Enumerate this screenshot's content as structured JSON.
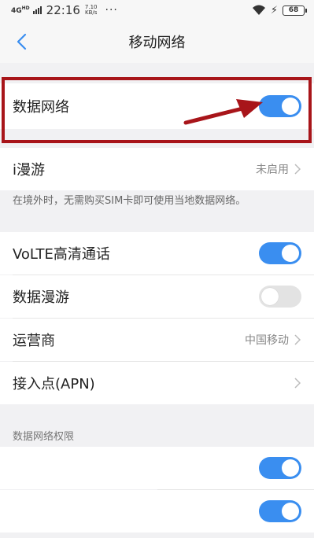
{
  "status_bar": {
    "network": "4G",
    "network_sup": "HD",
    "time": "22:16",
    "speed_value": "7.10",
    "speed_unit": "KB/s",
    "more": "···",
    "battery": "68"
  },
  "header": {
    "title": "移动网络",
    "back_icon": "chevron-left-icon"
  },
  "data_network": {
    "label": "数据网络",
    "enabled": true
  },
  "i_roaming": {
    "label": "i漫游",
    "value": "未启用"
  },
  "roaming_note": "在境外时，无需购买SIM卡即可使用当地数据网络。",
  "volte": {
    "label": "VoLTE高清通话",
    "enabled": true
  },
  "data_roaming": {
    "label": "数据漫游",
    "enabled": false
  },
  "carrier": {
    "label": "运营商",
    "value": "中国移动"
  },
  "apn": {
    "label": "接入点(APN)"
  },
  "permissions": {
    "header": "数据网络权限",
    "items": [
      {
        "enabled": true
      },
      {
        "enabled": true
      }
    ]
  },
  "colors": {
    "accent": "#3a8ef0",
    "annotation": "#a8151a"
  }
}
